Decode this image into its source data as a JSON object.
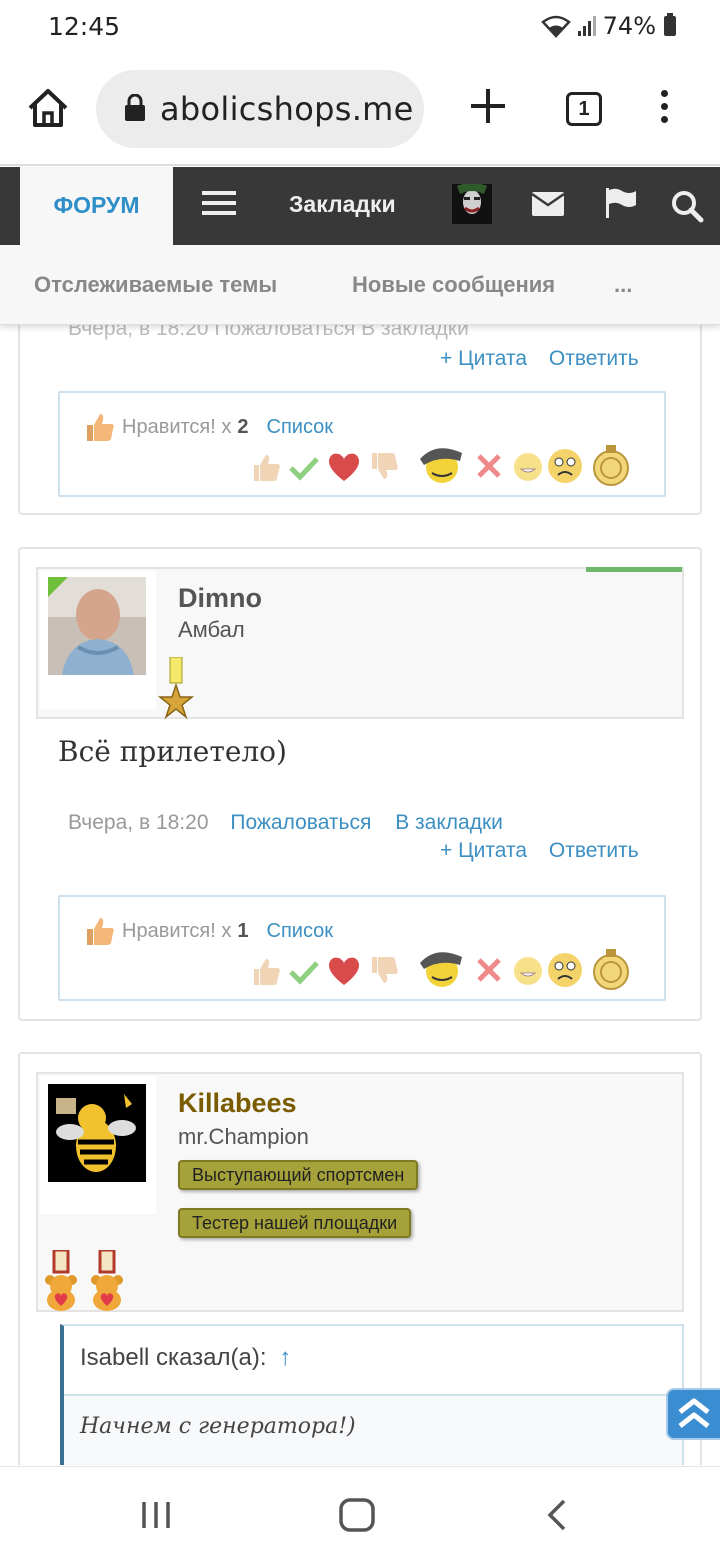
{
  "status": {
    "time": "12:45",
    "battery": "74%"
  },
  "browser": {
    "url": "abolicshops.me",
    "tab_count": "1"
  },
  "nav": {
    "forum": "ФОРУМ",
    "bookmarks": "Закладки"
  },
  "subnav": {
    "watched": "Отслеживаемые темы",
    "new_messages": "Новые сообщения",
    "more": "..."
  },
  "common": {
    "quote": "+ Цитата",
    "reply": "Ответить",
    "report": "Пожаловаться",
    "bookmark": "В закладки",
    "likes_label": "Нравится! х",
    "list": "Список"
  },
  "posts": [
    {
      "likes_count": "2",
      "partial_meta": "Вчера, в 18:20   Пожаловаться   В закладки"
    },
    {
      "author": "Dimno",
      "title": "Амбал",
      "message": "Всё прилетело)",
      "date": "Вчера, в 18:20",
      "likes_count": "1",
      "author_color": "#555555"
    },
    {
      "author": "Killabees",
      "title": "mr.Champion",
      "author_color": "#7a5b00",
      "badges": [
        "Выступающий спортсмен",
        "Тестер нашей площадки"
      ],
      "quote_author": "Isabell сказал(а):",
      "quote_arrow": "↑",
      "quote_text": "Начнем с генератора!)"
    }
  ]
}
